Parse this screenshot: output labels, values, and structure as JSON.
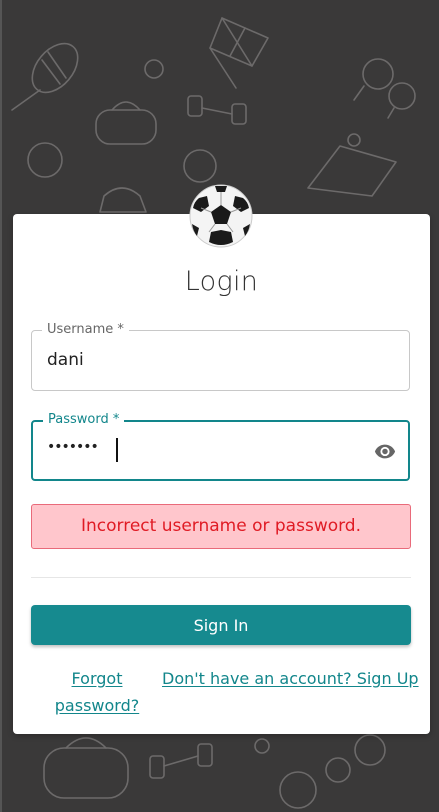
{
  "login": {
    "title": "Login",
    "username": {
      "label": "Username *",
      "value": "dani"
    },
    "password": {
      "label": "Password *",
      "value_masked": "•••••••"
    },
    "error_message": "Incorrect username or password.",
    "sign_in_label": "Sign In",
    "forgot_password_label": "Forgot password?",
    "sign_up_label": "Don't have an account? Sign Up"
  },
  "icons": {
    "logo": "soccer-ball-icon",
    "password_toggle": "eye-icon"
  },
  "colors": {
    "accent": "#168a8f",
    "error_text": "#e01b24",
    "error_bg": "#ffc6cc",
    "background": "#3a3939"
  }
}
